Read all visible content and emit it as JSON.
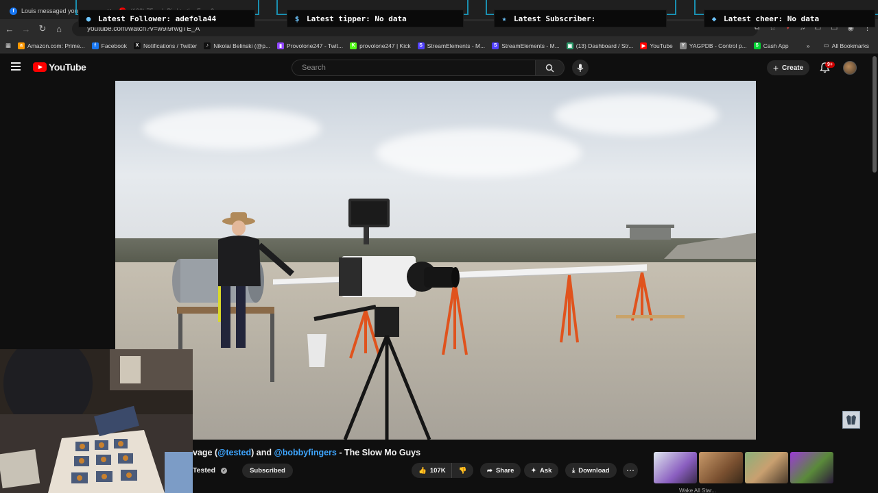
{
  "browser": {
    "tabs": [
      {
        "label": "Louis messaged you",
        "icon": "facebook-icon"
      },
      {
        "label": "(182) 75mph Bird to the Face?",
        "icon": "youtube-icon"
      }
    ],
    "url": "youtube.com/watch?v=w9l9rwgTE_A",
    "bookmarks": [
      {
        "label": "Amazon.com: Prime...",
        "icon": "amazon-icon",
        "color": "#ff9900"
      },
      {
        "label": "Facebook",
        "icon": "facebook-icon",
        "color": "#1877f2"
      },
      {
        "label": "Notifications / Twitter",
        "icon": "x-twitter-icon",
        "color": "#111111"
      },
      {
        "label": "Nikolai Belinski (@p...",
        "icon": "tiktok-icon",
        "color": "#111111"
      },
      {
        "label": "Provolone247 - Twit...",
        "icon": "twitch-icon",
        "color": "#9146ff"
      },
      {
        "label": "provolone247 | Kick",
        "icon": "kick-icon",
        "color": "#53fc18"
      },
      {
        "label": "StreamElements - M...",
        "icon": "streamelements-icon",
        "color": "#5140ff"
      },
      {
        "label": "StreamElements - M...",
        "icon": "streamelements-icon",
        "color": "#5140ff"
      },
      {
        "label": "(13) Dashboard / Str...",
        "icon": "dashboard-icon",
        "color": "#2f9e6e"
      },
      {
        "label": "YouTube",
        "icon": "youtube-icon",
        "color": "#ff0000"
      },
      {
        "label": "YAGPDB - Control p...",
        "icon": "yagpdb-icon",
        "color": "#888888"
      },
      {
        "label": "Cash App",
        "icon": "cashapp-icon",
        "color": "#00d632"
      }
    ],
    "all_bookmarks": "All Bookmarks"
  },
  "overlay": {
    "latest_follower": "Latest Follower: adefola44",
    "latest_tipper": "Latest tipper: No data",
    "latest_subscriber": "Latest Subscriber:",
    "latest_cheer": "Latest cheer: No data"
  },
  "youtube": {
    "logo_text": "YouTube",
    "search_placeholder": "Search",
    "create_label": "Create",
    "notification_count": "9+"
  },
  "video": {
    "title_prefix": "vage (",
    "mention_tested": "@tested",
    "title_mid": ") and ",
    "mention_bobby": "@bobbyfingers",
    "title_suffix": " - The Slow Mo Guys",
    "channel_name": "Tested",
    "subscribe_state": "Subscribed",
    "likes": "107K",
    "share_label": "Share",
    "ask_label": "Ask",
    "download_label": "Download",
    "more_label": "⋯"
  },
  "sidebar_suggestion": {
    "caption": "Wake All Star..."
  },
  "colors": {
    "overlay_frame": "#1a8fb0",
    "youtube_red": "#ff0000",
    "mention_blue": "#3ea6ff",
    "cone_orange": "#e0531d"
  }
}
